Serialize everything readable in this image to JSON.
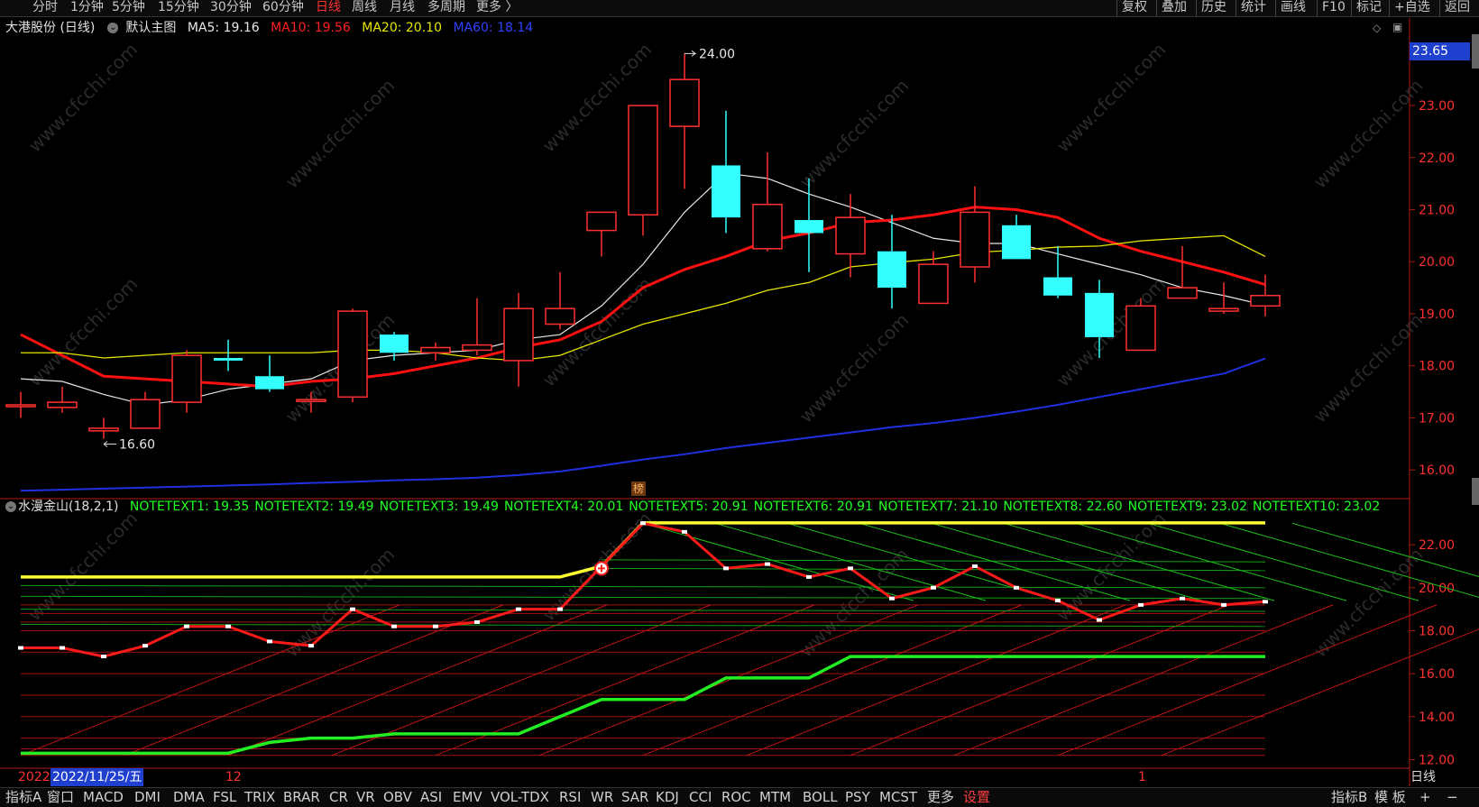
{
  "toolbar": {
    "periods": [
      "分时",
      "1分钟",
      "5分钟",
      "15分钟",
      "30分钟",
      "60分钟",
      "日线",
      "周线",
      "月线",
      "多周期",
      "更多 〉"
    ],
    "active_period": "日线",
    "right": [
      "复权",
      "叠加",
      "历史",
      "统计",
      "画线",
      "F10",
      "标记",
      "+自选",
      "返回"
    ]
  },
  "main_info": {
    "stock": "大港股份 (日线)",
    "view": "默认主图",
    "ma5": "MA5: 19.16",
    "ma10": "MA10: 19.56",
    "ma20": "MA20: 20.10",
    "ma60": "MA60: 18.14"
  },
  "colors": {
    "up": "#ff3030",
    "down": "#33ffff",
    "ma5": "#e8e8e8",
    "ma10": "#ff1010",
    "ma20": "#e6e600",
    "ma60": "#2030e0",
    "axis": "#b01818",
    "grid": "#3a0a0a",
    "yellow_line": "#ffff33",
    "green_line": "#22ee22"
  },
  "price_axis": {
    "ticks": [
      "24.00",
      "23.00",
      "22.00",
      "21.00",
      "20.00",
      "19.00",
      "18.00",
      "17.00",
      "16.00"
    ],
    "current": "23.65"
  },
  "annotations": {
    "high": "24.00",
    "low": "16.60",
    "rank_badge": "榜"
  },
  "indicator_info": {
    "name": "水漫金山(18,2,1)",
    "notes": [
      "NOTETEXT1: 19.35",
      "NOTETEXT2: 19.49",
      "NOTETEXT3: 19.49",
      "NOTETEXT4: 20.01",
      "NOTETEXT5: 20.91",
      "NOTETEXT6: 20.91",
      "NOTETEXT7: 21.10",
      "NOTETEXT8: 22.60",
      "NOTETEXT9: 23.02",
      "NOTETEXT10: 23.02"
    ]
  },
  "indicator_axis": {
    "ticks": [
      "22.00",
      "20.00",
      "18.00",
      "16.00",
      "14.00",
      "12.00"
    ]
  },
  "xaxis": {
    "start": "2022",
    "cursor_date": "2022/11/25/五",
    "mark_12": "12",
    "mark_1": "1",
    "period": "日线"
  },
  "bottom_tabs": {
    "items": [
      "指标A",
      "窗口",
      "MACD",
      "DMI",
      "DMA",
      "FSL",
      "TRIX",
      "BRAR",
      "CR",
      "VR",
      "OBV",
      "ASI",
      "EMV",
      "VOL-TDX",
      "RSI",
      "WR",
      "SAR",
      "KDJ",
      "CCI",
      "ROC",
      "MTM",
      "BOLL",
      "PSY",
      "MCST",
      "更多",
      "设置"
    ],
    "right": [
      "指标B",
      "模 板",
      "+",
      "−"
    ]
  },
  "chart_data": [
    {
      "type": "candlestick",
      "title": "大港股份 (日线)",
      "ylim": [
        15.5,
        24.3
      ],
      "candles": [
        {
          "o": 17.25,
          "h": 17.5,
          "l": 17.0,
          "c": 17.25
        },
        {
          "o": 17.2,
          "h": 17.6,
          "l": 17.1,
          "c": 17.3
        },
        {
          "o": 16.75,
          "h": 17.0,
          "l": 16.6,
          "c": 16.8
        },
        {
          "o": 16.8,
          "h": 17.5,
          "l": 16.8,
          "c": 17.35
        },
        {
          "o": 17.3,
          "h": 18.3,
          "l": 17.1,
          "c": 18.2
        },
        {
          "o": 18.15,
          "h": 18.5,
          "l": 17.9,
          "c": 18.1
        },
        {
          "o": 17.8,
          "h": 18.2,
          "l": 17.5,
          "c": 17.55
        },
        {
          "o": 17.35,
          "h": 17.5,
          "l": 17.1,
          "c": 17.35
        },
        {
          "o": 17.4,
          "h": 19.1,
          "l": 17.3,
          "c": 19.05
        },
        {
          "o": 18.6,
          "h": 18.65,
          "l": 18.1,
          "c": 18.25
        },
        {
          "o": 18.25,
          "h": 18.45,
          "l": 18.1,
          "c": 18.35
        },
        {
          "o": 18.3,
          "h": 19.3,
          "l": 18.2,
          "c": 18.4
        },
        {
          "o": 18.1,
          "h": 19.4,
          "l": 17.6,
          "c": 19.1
        },
        {
          "o": 18.8,
          "h": 19.8,
          "l": 18.7,
          "c": 19.1
        },
        {
          "o": 20.6,
          "h": 20.9,
          "l": 20.1,
          "c": 20.95
        },
        {
          "o": 20.9,
          "h": 22.2,
          "l": 20.5,
          "c": 23.0
        },
        {
          "o": 22.6,
          "h": 24.0,
          "l": 21.4,
          "c": 23.5
        },
        {
          "o": 21.85,
          "h": 22.9,
          "l": 20.55,
          "c": 20.85
        },
        {
          "o": 20.25,
          "h": 22.1,
          "l": 20.2,
          "c": 21.1
        },
        {
          "o": 20.8,
          "h": 21.6,
          "l": 19.8,
          "c": 20.55
        },
        {
          "o": 20.15,
          "h": 21.3,
          "l": 19.7,
          "c": 20.85
        },
        {
          "o": 20.2,
          "h": 20.9,
          "l": 19.1,
          "c": 19.5
        },
        {
          "o": 19.2,
          "h": 20.2,
          "l": 19.2,
          "c": 19.95
        },
        {
          "o": 19.9,
          "h": 21.45,
          "l": 19.6,
          "c": 20.95
        },
        {
          "o": 20.7,
          "h": 20.9,
          "l": 20.05,
          "c": 20.05
        },
        {
          "o": 19.7,
          "h": 20.3,
          "l": 19.3,
          "c": 19.35
        },
        {
          "o": 19.4,
          "h": 19.65,
          "l": 18.15,
          "c": 18.55
        },
        {
          "o": 18.3,
          "h": 19.3,
          "l": 18.3,
          "c": 19.15
        },
        {
          "o": 19.3,
          "h": 20.3,
          "l": 19.3,
          "c": 19.5
        },
        {
          "o": 19.05,
          "h": 19.6,
          "l": 19.0,
          "c": 19.1
        },
        {
          "o": 19.15,
          "h": 19.75,
          "l": 18.95,
          "c": 19.35
        }
      ],
      "series": [
        {
          "name": "MA5",
          "values": [
            17.75,
            17.7,
            17.45,
            17.25,
            17.35,
            17.55,
            17.65,
            17.75,
            18.1,
            18.2,
            18.25,
            18.3,
            18.5,
            18.6,
            19.15,
            19.95,
            20.95,
            21.7,
            21.6,
            21.3,
            21.05,
            20.75,
            20.45,
            20.35,
            20.35,
            20.15,
            19.95,
            19.75,
            19.5,
            19.35,
            19.16
          ]
        },
        {
          "name": "MA10",
          "values": [
            18.6,
            18.2,
            17.8,
            17.75,
            17.7,
            17.65,
            17.6,
            17.7,
            17.75,
            17.85,
            18.0,
            18.15,
            18.35,
            18.5,
            18.85,
            19.5,
            19.85,
            20.1,
            20.4,
            20.55,
            20.75,
            20.8,
            20.9,
            21.05,
            21.0,
            20.85,
            20.45,
            20.2,
            20.0,
            19.8,
            19.56
          ]
        },
        {
          "name": "MA20",
          "values": [
            18.25,
            18.25,
            18.15,
            18.2,
            18.25,
            18.25,
            18.25,
            18.25,
            18.3,
            18.3,
            18.25,
            18.15,
            18.1,
            18.2,
            18.5,
            18.8,
            19.0,
            19.2,
            19.45,
            19.6,
            19.9,
            19.98,
            20.05,
            20.18,
            20.22,
            20.28,
            20.3,
            20.4,
            20.45,
            20.5,
            20.1
          ]
        },
        {
          "name": "MA60",
          "values": [
            15.6,
            15.62,
            15.64,
            15.66,
            15.68,
            15.7,
            15.72,
            15.75,
            15.77,
            15.8,
            15.82,
            15.85,
            15.9,
            15.97,
            16.08,
            16.2,
            16.3,
            16.42,
            16.52,
            16.62,
            16.72,
            16.82,
            16.9,
            17.0,
            17.12,
            17.25,
            17.4,
            17.55,
            17.7,
            17.85,
            18.14
          ]
        }
      ]
    },
    {
      "type": "line",
      "title": "水漫金山(18,2,1)",
      "ylim": [
        11.6,
        23.6
      ],
      "series": [
        {
          "name": "main",
          "values": [
            17.2,
            17.2,
            16.8,
            17.3,
            18.2,
            18.2,
            17.5,
            17.3,
            19.0,
            18.2,
            18.2,
            18.4,
            19.0,
            19.0,
            21.0,
            23.0,
            22.6,
            20.9,
            21.1,
            20.5,
            20.9,
            19.5,
            20.0,
            21.0,
            20.0,
            19.4,
            18.5,
            19.2,
            19.5,
            19.2,
            19.35
          ]
        },
        {
          "name": "yellow",
          "values": [
            20.5,
            20.5,
            20.5,
            20.5,
            20.5,
            20.5,
            20.5,
            20.5,
            20.5,
            20.5,
            20.5,
            20.5,
            20.5,
            20.5,
            21.0,
            23.02,
            23.02,
            23.02,
            23.02,
            23.02,
            23.02,
            23.02,
            23.02,
            23.02,
            23.02,
            23.02,
            23.02,
            23.02,
            23.02,
            23.02,
            23.02
          ]
        },
        {
          "name": "green",
          "values": [
            12.3,
            12.3,
            12.3,
            12.3,
            12.3,
            12.3,
            12.8,
            13.0,
            13.0,
            13.2,
            13.2,
            13.2,
            13.2,
            14.0,
            14.8,
            14.8,
            14.8,
            15.8,
            15.8,
            15.8,
            16.8,
            16.8,
            16.8,
            16.8,
            16.8,
            16.8,
            16.8,
            16.8,
            16.8,
            16.8,
            16.8
          ]
        }
      ]
    }
  ]
}
